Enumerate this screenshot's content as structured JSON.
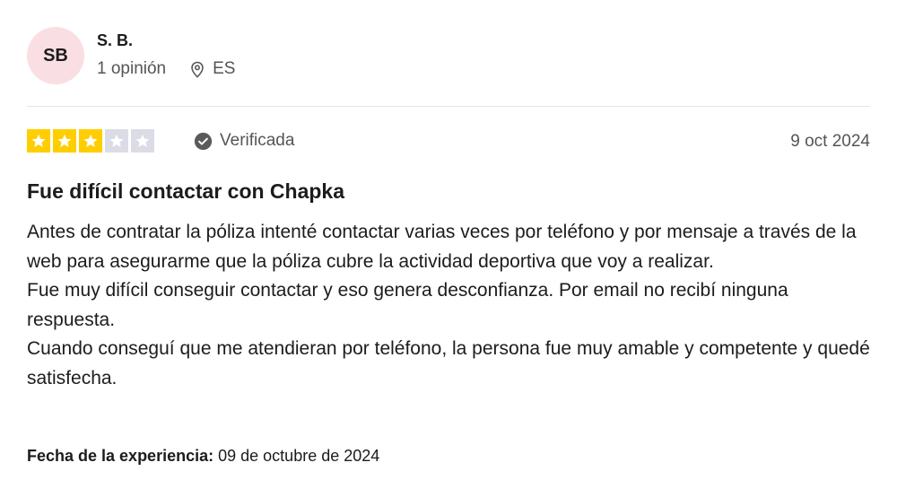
{
  "reviewer": {
    "initials": "SB",
    "name": "S. B.",
    "reviews_count": "1 opinión",
    "country": "ES",
    "avatar_color": "#f9dfe3"
  },
  "review": {
    "rating": 3,
    "max_rating": 5,
    "star_color": "#ffce00",
    "verified_label": "Verificada",
    "date": "9 oct 2024",
    "title": "Fue difícil contactar con Chapka",
    "paragraphs": [
      "Antes de contratar la póliza intenté contactar varias veces por teléfono y por mensaje a través de la web para asegurarme que la póliza cubre la actividad deportiva que voy a realizar.",
      "Fue muy difícil conseguir contactar y eso genera desconfianza. Por email no recibí ninguna respuesta.",
      "Cuando conseguí que me atendieran por teléfono, la persona fue muy amable y competente y quedé satisfecha."
    ],
    "experience_label": "Fecha de la experiencia:",
    "experience_date": "09 de octubre de 2024"
  },
  "icons": {
    "location": "location-pin-icon",
    "verified": "verified-check-icon",
    "star": "star-icon"
  }
}
